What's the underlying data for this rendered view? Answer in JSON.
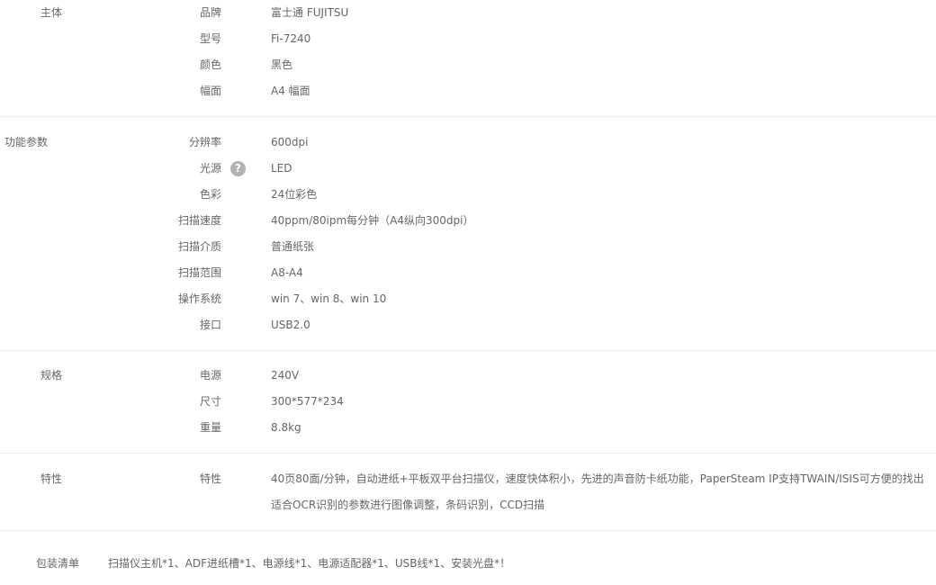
{
  "groups": [
    {
      "title": "主体",
      "rows": [
        {
          "label": "品牌",
          "value": "富士通 FUJITSU"
        },
        {
          "label": "型号",
          "value": "Fi-7240"
        },
        {
          "label": "颜色",
          "value": "黑色"
        },
        {
          "label": "幅面",
          "value": "A4 幅面"
        }
      ]
    },
    {
      "title": "功能参数",
      "rows": [
        {
          "label": "分辨率",
          "value": "600dpi"
        },
        {
          "label": "光源",
          "value": "LED",
          "help": "?"
        },
        {
          "label": "色彩",
          "value": "24位彩色"
        },
        {
          "label": "扫描速度",
          "value": "40ppm/80ipm每分钟（A4纵向300dpi）"
        },
        {
          "label": "扫描介质",
          "value": "普通纸张"
        },
        {
          "label": "扫描范围",
          "value": "A8-A4"
        },
        {
          "label": "操作系统",
          "value": "win 7、win 8、win 10"
        },
        {
          "label": "接口",
          "value": "USB2.0"
        }
      ]
    },
    {
      "title": "规格",
      "rows": [
        {
          "label": "电源",
          "value": "240V"
        },
        {
          "label": "尺寸",
          "value": "300*577*234"
        },
        {
          "label": "重量",
          "value": "8.8kg"
        }
      ]
    },
    {
      "title": "特性",
      "rows": [
        {
          "label": "特性",
          "value": "40页80面/分钟，自动进纸+平板双平台扫描仪，速度快体积小，先进的声音防卡纸功能，PaperSteam IP支持TWAIN/ISIS可方便的找出适合OCR识别的参数进行图像调整，条码识别，CCD扫描"
        }
      ]
    }
  ],
  "package": {
    "title": "包装清单",
    "value": "扫描仪主机*1、ADF进纸槽*1、电源线*1、电源适配器*1、USB线*1、安装光盘*！"
  }
}
